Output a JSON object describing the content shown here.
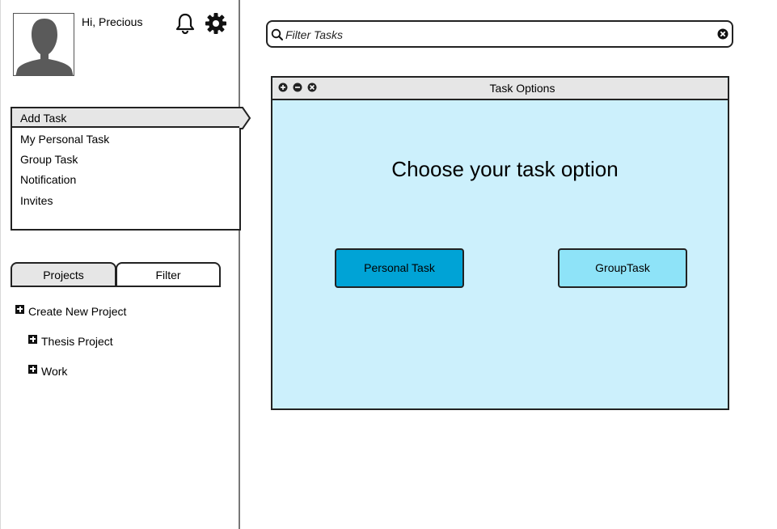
{
  "user": {
    "greeting": "Hi, Precious"
  },
  "header_icons": [
    "bell-icon",
    "gear-icon"
  ],
  "menu": {
    "items": [
      {
        "label": "Add Task",
        "active": true
      },
      {
        "label": "My Personal Task"
      },
      {
        "label": "Group Task"
      },
      {
        "label": "Notification"
      },
      {
        "label": "Invites"
      }
    ]
  },
  "tabs": [
    {
      "label": "Projects",
      "active": true
    },
    {
      "label": "Filter"
    }
  ],
  "projects": {
    "create_label": "Create New Project",
    "items": [
      {
        "label": "Thesis Project"
      },
      {
        "label": "Work"
      }
    ]
  },
  "search": {
    "placeholder": "Filter Tasks"
  },
  "dialog": {
    "title": "Task Options",
    "heading": "Choose your task option",
    "buttons": {
      "personal": "Personal Task",
      "group": "GroupTask"
    }
  },
  "colors": {
    "dialog_bg": "#ccf0fc",
    "personal_btn": "#00a3d6",
    "group_btn": "#8ee3f8",
    "titlebar_bg": "#e6e6e6"
  }
}
